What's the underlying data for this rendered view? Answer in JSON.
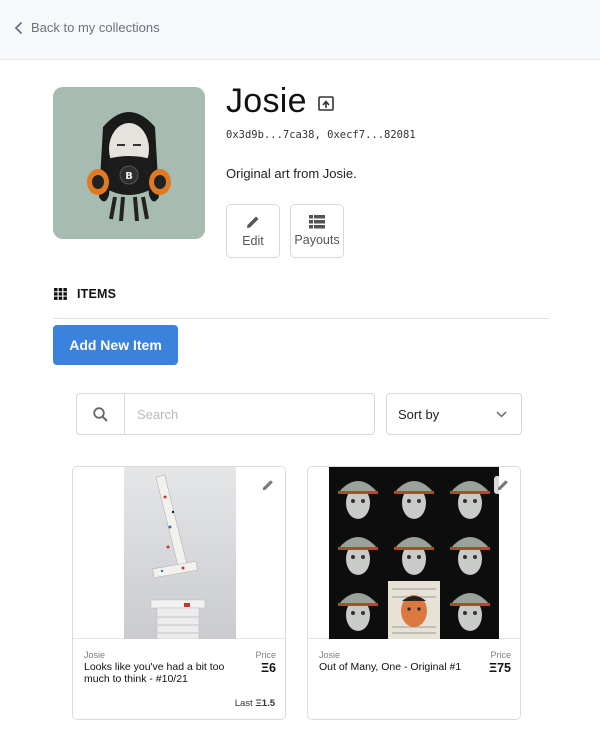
{
  "topbar": {
    "back_label": "Back to my collections"
  },
  "collection": {
    "name": "Josie",
    "addresses": "0x3d9b...7ca38, 0xecf7...82081",
    "description": "Original art from Josie.",
    "avatar_bg": "#a7bcb0"
  },
  "actions": {
    "edit_label": "Edit",
    "payouts_label": "Payouts"
  },
  "items_section": {
    "heading": "ITEMS",
    "add_button_label": "Add New Item"
  },
  "search": {
    "placeholder": "Search",
    "value": ""
  },
  "sort": {
    "label": "Sort by"
  },
  "colors": {
    "accent": "#3b82dd",
    "border": "#d5d8dc",
    "topbar_bg": "#f7f8fa"
  },
  "cards": [
    {
      "creator": "Josie",
      "name": "Looks like you've had a bit too much to think - #10/21",
      "price_label": "Price",
      "price": "Ξ6",
      "last_label": "Last",
      "last_value": "Ξ1.5"
    },
    {
      "creator": "Josie",
      "name": "Out of Many, One - Original #1",
      "price_label": "Price",
      "price": "Ξ75"
    }
  ]
}
